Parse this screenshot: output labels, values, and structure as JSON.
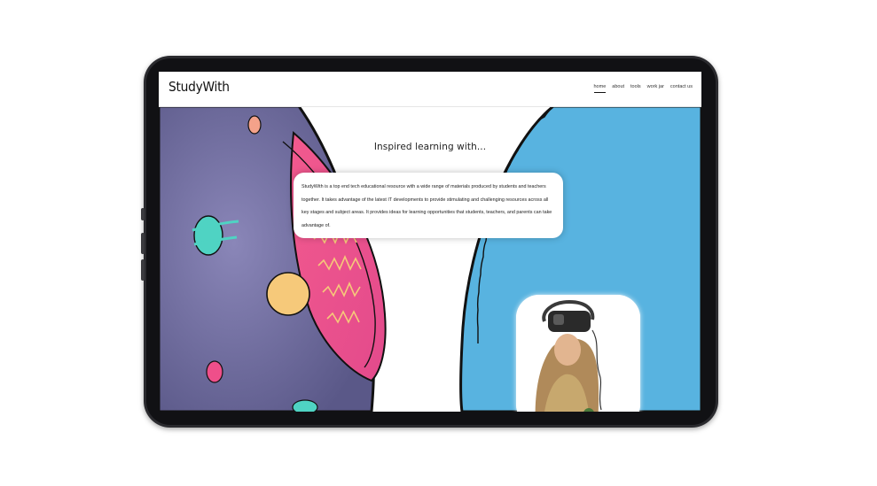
{
  "site": {
    "logo": "StudyWith",
    "nav": [
      "home",
      "about",
      "tools",
      "work jar",
      "contact us"
    ],
    "active_nav": "home"
  },
  "hero": {
    "headline": "Inspired learning with...",
    "description": "StudyWith is a top end tech educational resource with a wide range of materials produced by students and teachers together. It takes advantage of the latest IT developments to provide stimulating and challenging resources across all key stages and subject areas. It provides ideas for learning opportunities that students, teachers, and parents can take advantage of."
  },
  "colors": {
    "planet_purple": "#6e6aa0",
    "planet_pink": "#ef4f8a",
    "planet_yellow": "#f6c97a",
    "planet_teal": "#4fd3c3",
    "right_blue": "#58b3e0",
    "outline": "#111111"
  },
  "icons": {
    "photo": "vr-headset-student-image"
  }
}
